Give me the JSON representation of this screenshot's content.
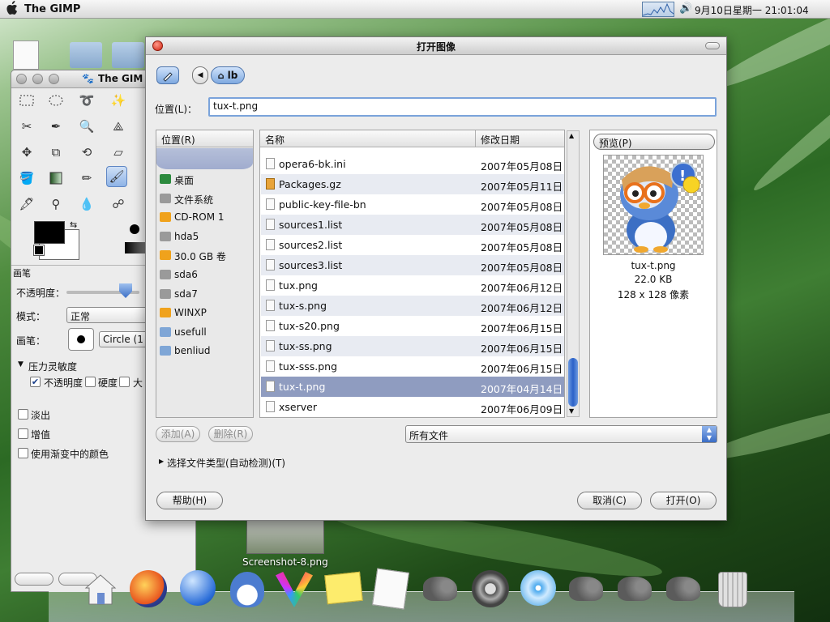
{
  "menubar": {
    "app_title": "The GIMP",
    "clock": "9月10日星期一 21:01:04"
  },
  "toolbox": {
    "title": "The GIM",
    "brush_section": "画笔",
    "opacity_label": "不透明度：",
    "mode_label": "模式：",
    "mode_value": "正常",
    "brush_label": "画笔：",
    "brush_value": "Circle (1",
    "pressure_label": "压力灵敏度",
    "pressure_opacity": "不透明度",
    "pressure_hardness": "硬度",
    "pressure_size": "大",
    "fade_label": "淡出",
    "increment_label": "增值",
    "gradient_label": "使用渐变中的颜色"
  },
  "desktop": {
    "screenshot_label": "Screenshot-8.png"
  },
  "dialog": {
    "title": "打开图像",
    "path_button": "lb",
    "location_label": "位置(L)：",
    "location_value": "tux-t.png",
    "places_header": "位置(R)",
    "places": [
      {
        "label": "桌面",
        "icon": "desktop-icon"
      },
      {
        "label": "文件系统",
        "icon": "harddisk-icon"
      },
      {
        "label": "CD-ROM 1",
        "icon": "cdrom-icon"
      },
      {
        "label": "hda5",
        "icon": "harddisk-icon"
      },
      {
        "label": "30.0 GB 卷",
        "icon": "volume-icon"
      },
      {
        "label": "sda6",
        "icon": "harddisk-icon"
      },
      {
        "label": "sda7",
        "icon": "harddisk-icon"
      },
      {
        "label": "WINXP",
        "icon": "volume-icon"
      },
      {
        "label": "usefull",
        "icon": "folder-icon"
      },
      {
        "label": "benliud",
        "icon": "folder-icon"
      }
    ],
    "columns": {
      "name": "名称",
      "date": "修改日期"
    },
    "files": [
      {
        "name": "opera6-bk.ini",
        "date": "2007年05月08日"
      },
      {
        "name": "Packages.gz",
        "date": "2007年05月11日"
      },
      {
        "name": "public-key-file-bn",
        "date": "2007年05月08日"
      },
      {
        "name": "sources1.list",
        "date": "2007年05月08日"
      },
      {
        "name": "sources2.list",
        "date": "2007年05月08日"
      },
      {
        "name": "sources3.list",
        "date": "2007年05月08日"
      },
      {
        "name": "tux.png",
        "date": "2007年06月12日"
      },
      {
        "name": "tux-s.png",
        "date": "2007年06月12日"
      },
      {
        "name": "tux-s20.png",
        "date": "2007年06月15日"
      },
      {
        "name": "tux-ss.png",
        "date": "2007年06月15日"
      },
      {
        "name": "tux-sss.png",
        "date": "2007年06月15日"
      },
      {
        "name": "tux-t.png",
        "date": "2007年04月14日"
      },
      {
        "name": "xserver",
        "date": "2007年06月09日"
      }
    ],
    "selected_file": "tux-t.png",
    "preview_label": "预览(P)",
    "preview_name": "tux-t.png",
    "preview_size": "22.0 KB",
    "preview_dims": "128 x 128 像素",
    "add_button": "添加(A)",
    "remove_button": "删除(R)",
    "filter_value": "所有文件",
    "filetype_expander": "选择文件类型(自动检测)(T)",
    "help_button": "帮助(H)",
    "cancel_button": "取消(C)",
    "open_button": "打开(O)"
  },
  "colors": {
    "selection": "#8f9cc0",
    "accent": "#5e86c4",
    "close": "#d0200e"
  }
}
